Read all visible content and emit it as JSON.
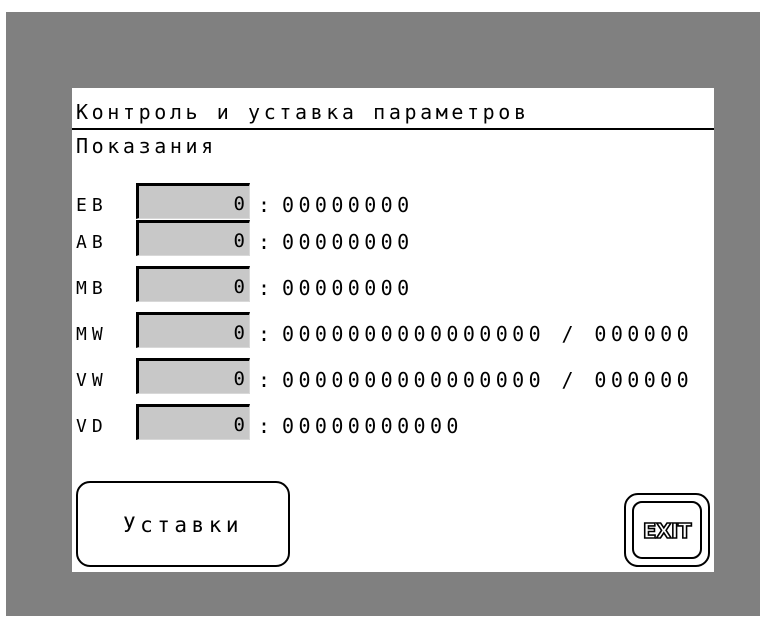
{
  "screen": {
    "title": "Контроль и уставка параметров",
    "section_title": "Показания"
  },
  "rows": [
    {
      "label": "EB",
      "value": "0",
      "sep": ":",
      "detail": "00000000"
    },
    {
      "label": "AB",
      "value": "0",
      "sep": ":",
      "detail": "00000000"
    },
    {
      "label": "MB",
      "value": "0",
      "sep": ":",
      "detail": "00000000"
    },
    {
      "label": "MW",
      "value": "0",
      "sep": ":",
      "detail": "0000000000000000 / 000000"
    },
    {
      "label": "VW",
      "value": "0",
      "sep": ":",
      "detail": "0000000000000000 / 000000"
    },
    {
      "label": "VD",
      "value": "0",
      "sep": ":",
      "detail": "00000000000"
    }
  ],
  "buttons": {
    "settings_label": "Уставки",
    "exit_label": "EXIT"
  },
  "colors": {
    "frame": "#808080",
    "screen": "#ffffff",
    "value_box": "#c8c8c8"
  }
}
